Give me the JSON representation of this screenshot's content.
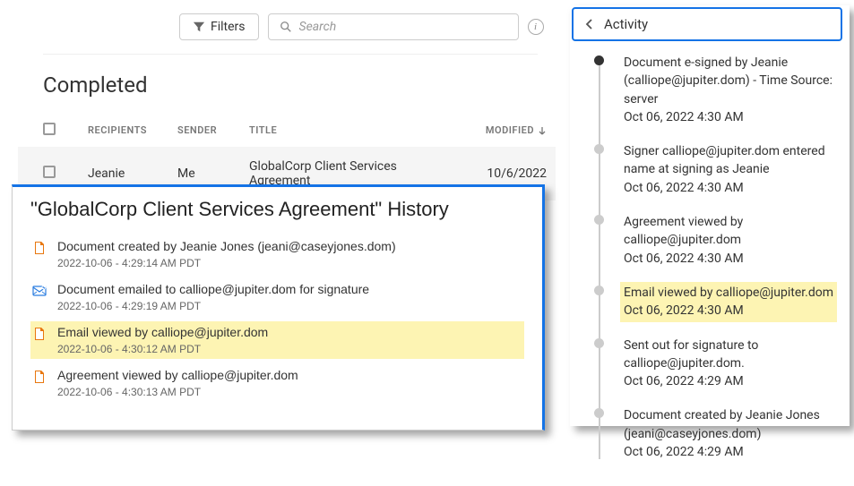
{
  "filterBar": {
    "filtersLabel": "Filters",
    "searchPlaceholder": "Search"
  },
  "sectionHeading": "Completed",
  "table": {
    "headers": {
      "recipients": "RECIPIENTS",
      "sender": "SENDER",
      "title": "TITLE",
      "modified": "MODIFIED"
    },
    "row": {
      "recipient": "Jeanie",
      "sender": "Me",
      "title": "GlobalCorp Client Services Agreement",
      "modified": "10/6/2022"
    }
  },
  "history": {
    "title": "\"GlobalCorp Client Services Agreement\" History",
    "items": [
      {
        "icon": "doc",
        "desc": "Document created by Jeanie Jones (jeani@caseyjones.dom)",
        "time": "2022-10-06 - 4:29:14 AM PDT",
        "highlighted": false
      },
      {
        "icon": "mail",
        "desc": "Document emailed to calliope@jupiter.dom for signature",
        "time": "2022-10-06 - 4:29:19 AM PDT",
        "highlighted": false
      },
      {
        "icon": "doc",
        "desc": "Email viewed by calliope@jupiter.dom",
        "time": "2022-10-06 - 4:30:12 AM PDT",
        "highlighted": true
      },
      {
        "icon": "doc",
        "desc": "Agreement viewed by calliope@jupiter.dom",
        "time": "2022-10-06 - 4:30:13 AM PDT",
        "highlighted": false
      }
    ]
  },
  "activity": {
    "headerLabel": "Activity",
    "items": [
      {
        "filled": true,
        "highlighted": false,
        "text": "Document e-signed by Jeanie (calliope@jupiter.dom) - Time Source: server",
        "date": "Oct 06, 2022 4:30 AM"
      },
      {
        "filled": false,
        "highlighted": false,
        "text": "Signer calliope@jupiter.dom entered name at signing as Jeanie",
        "date": "Oct 06, 2022 4:30 AM"
      },
      {
        "filled": false,
        "highlighted": false,
        "text": "Agreement viewed by calliope@jupiter.dom",
        "date": "Oct 06, 2022 4:30 AM"
      },
      {
        "filled": false,
        "highlighted": true,
        "text": "Email viewed by calliope@jupiter.dom",
        "date": "Oct 06, 2022 4:30 AM"
      },
      {
        "filled": false,
        "highlighted": false,
        "text": "Sent out for signature to calliope@jupiter.dom.",
        "date": "Oct 06, 2022 4:29 AM"
      },
      {
        "filled": false,
        "highlighted": false,
        "text": "Document created by Jeanie Jones (jeani@caseyjones.dom)",
        "date": "Oct 06, 2022 4:29 AM"
      }
    ]
  }
}
